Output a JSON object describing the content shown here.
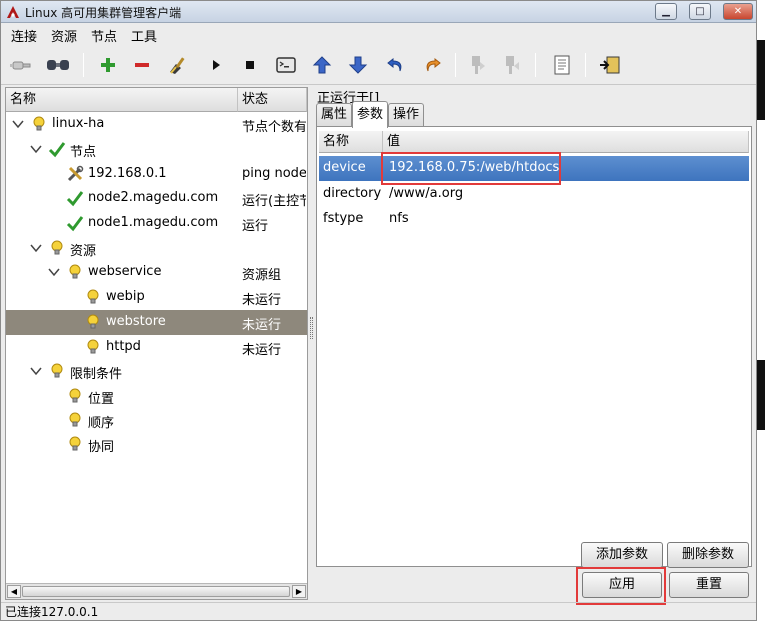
{
  "window": {
    "title": "Linux 高可用集群管理客户端",
    "minimize_symbol": "▁",
    "maximize_symbol": "□",
    "close_symbol": "✕"
  },
  "menu": [
    "连接",
    "资源",
    "节点",
    "工具"
  ],
  "toolbar_icons": [
    "connect-icon",
    "disconnect-icon",
    "add-icon",
    "remove-icon",
    "cleanup-icon",
    "start-icon",
    "stop-icon",
    "terminal-icon",
    "move-up-icon",
    "move-down-icon",
    "undo-icon",
    "redo-icon",
    "migrate-icon",
    "unmigrate-icon",
    "view-xml-icon",
    "exit-icon"
  ],
  "tree": {
    "col_name": "名称",
    "col_status": "状态",
    "rows": [
      {
        "label": "linux-ha",
        "status": "节点个数有",
        "icon": "bulb-icon"
      },
      {
        "label": "节点",
        "status": "",
        "icon": "check-icon"
      },
      {
        "label": "192.168.0.1",
        "status": "ping node",
        "icon": "tools-icon"
      },
      {
        "label": "node2.magedu.com",
        "status": "运行(主控节点)",
        "icon": "check-icon"
      },
      {
        "label": "node1.magedu.com",
        "status": "运行",
        "icon": "check-icon"
      },
      {
        "label": "资源",
        "status": "",
        "icon": "bulb-icon"
      },
      {
        "label": "webservice",
        "status": "资源组",
        "icon": "bulb-icon"
      },
      {
        "label": "webip",
        "status": "未运行",
        "icon": "bulb-icon"
      },
      {
        "label": "webstore",
        "status": "未运行",
        "icon": "bulb-icon"
      },
      {
        "label": "httpd",
        "status": "未运行",
        "icon": "bulb-icon"
      },
      {
        "label": "限制条件",
        "status": "",
        "icon": "bulb-icon"
      },
      {
        "label": "位置",
        "status": "",
        "icon": "bulb-icon"
      },
      {
        "label": "顺序",
        "status": "",
        "icon": "bulb-icon"
      },
      {
        "label": "协同",
        "status": "",
        "icon": "bulb-icon"
      }
    ]
  },
  "right": {
    "title": "正运行于[]",
    "tabs": [
      "属性",
      "参数",
      "操作"
    ],
    "active_tab": "参数",
    "col_name": "名称",
    "col_value": "值",
    "params": [
      {
        "name": "device",
        "value": "192.168.0.75:/web/htdocs"
      },
      {
        "name": "directory",
        "value": "/www/a.org"
      },
      {
        "name": "fstype",
        "value": "nfs"
      }
    ],
    "add_param": "添加参数",
    "delete_param": "删除参数",
    "apply": "应用",
    "reset": "重置"
  },
  "status_bar": "已连接127.0.0.1",
  "colors": {
    "selection_blue": "#3e74be",
    "tree_selection": "#8e887c",
    "highlight_red": "#e23a3a"
  }
}
